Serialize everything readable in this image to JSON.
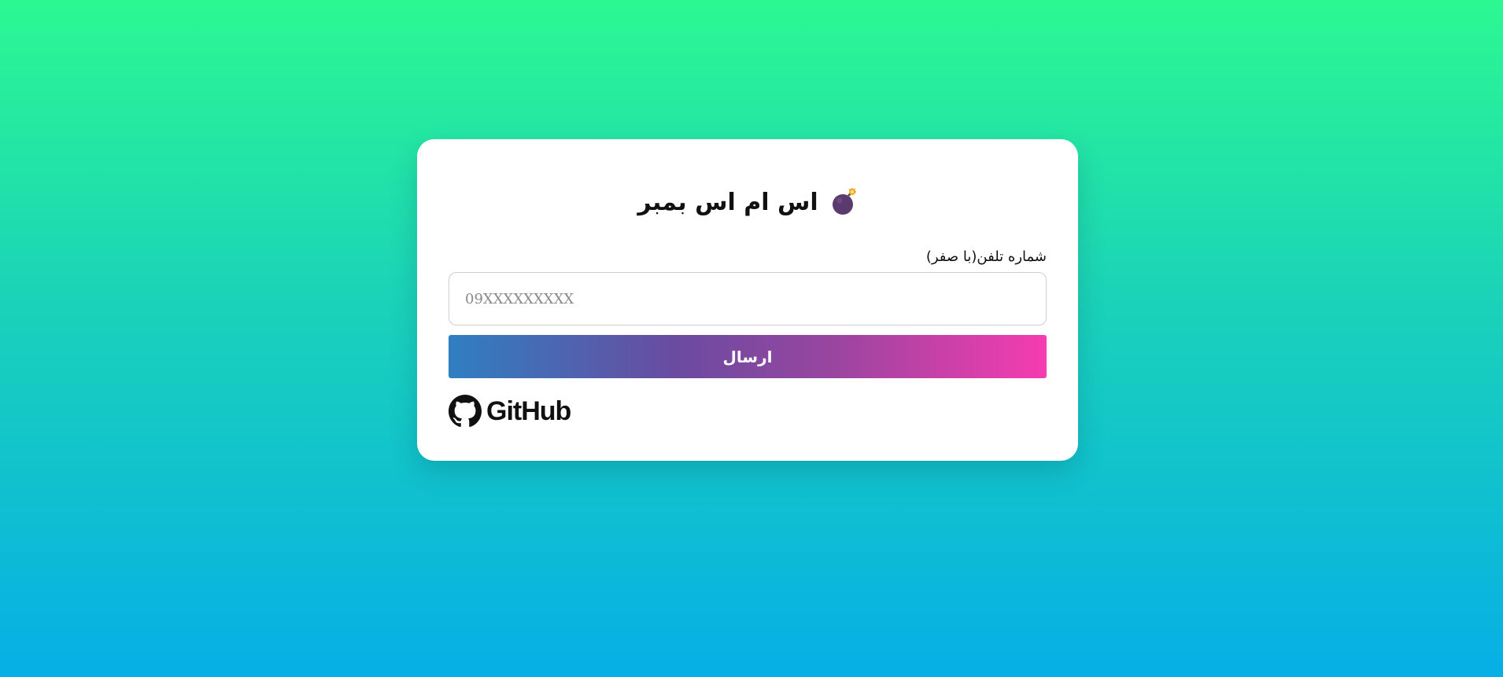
{
  "header": {
    "title": "اس ام اس بمبر",
    "icon": "bomb-icon"
  },
  "form": {
    "phone_label": "شماره تلفن(با صفر)",
    "phone_placeholder": "09XXXXXXXXX",
    "phone_value": "",
    "submit_label": "ارسال"
  },
  "footer": {
    "github_text": "GitHub",
    "github_icon": "github-icon"
  },
  "colors": {
    "background_top": "#2cf892",
    "background_bottom": "#06afe6",
    "button_gradient_start": "#2f7fc1",
    "button_gradient_end": "#f63cb0",
    "bomb_body": "#5b3a6e",
    "bomb_fuse_spark": "#f5a623"
  }
}
